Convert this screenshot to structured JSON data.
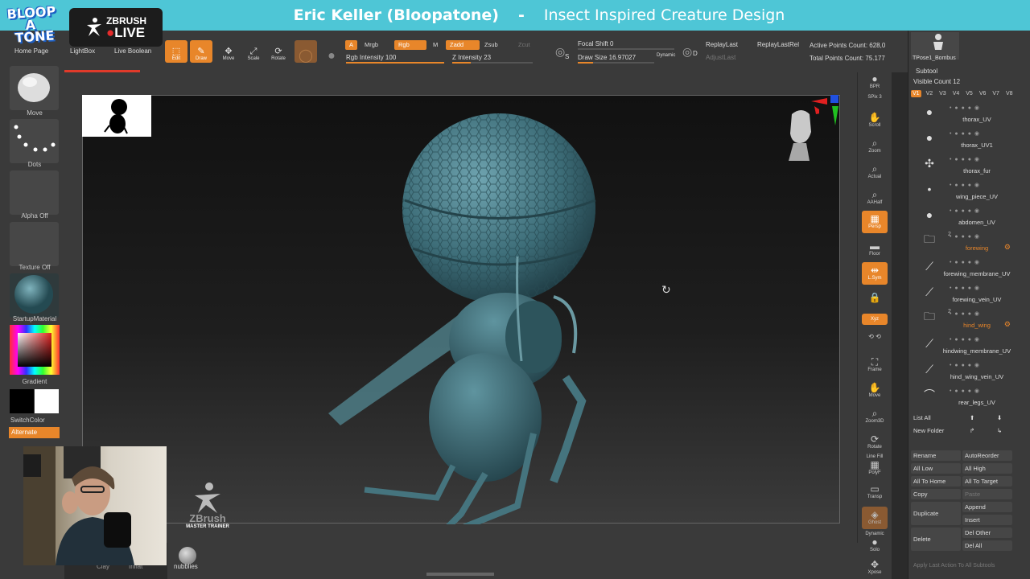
{
  "banner": {
    "author": "Eric Keller (Bloopatone)",
    "separator": "-",
    "course": "Insect Inspired Creature Design"
  },
  "logo": {
    "line1": "BLOOP",
    "line2": "A",
    "line3": "TONE"
  },
  "zbrush_live": {
    "top": "ZBRUSH",
    "live": "LIVE"
  },
  "top_nav": {
    "home_page": "Home Page",
    "lightbox": "LightBox",
    "live_boolean": "Live Boolean"
  },
  "tools": {
    "edit": "Edit",
    "draw": "Draw",
    "move": "Move",
    "scale": "Scale",
    "rotate": "Rotate"
  },
  "paint": {
    "a": "A",
    "mrgb": "Mrgb",
    "rgb": "Rgb",
    "m": "M",
    "zadd": "Zadd",
    "zsub": "Zsub",
    "zcut": "Zcut",
    "rgb_intensity": "Rgb Intensity 100",
    "z_intensity": "Z Intensity 23",
    "rgb_intensity_level": 1.0,
    "z_intensity_level": 0.23
  },
  "brush": {
    "focal_shift": "Focal Shift 0",
    "draw_size": "Draw Size 16.97027",
    "dynamic": "Dynamic",
    "s_key": "S",
    "d_key": "D"
  },
  "replay": {
    "replay_last": "ReplayLast",
    "replay_last_rel": "ReplayLastRel",
    "adjust_last": "AdjustLast"
  },
  "points": {
    "active": "Active Points Count: 628,0",
    "total": "Total Points Count: 75.177"
  },
  "left_panel": {
    "move": "Move",
    "dots": "Dots",
    "alpha": "Alpha Off",
    "texture": "Texture Off",
    "material": "StartupMaterial",
    "gradient": "Gradient",
    "switch_color": "SwitchColor",
    "alternate": "Alternate",
    "main_color": "#e02020"
  },
  "right_shelf": {
    "bpr": "BPR",
    "spix": "SPix 3",
    "scroll": "Scroll",
    "zoom": "Zoom",
    "actual": "Actual",
    "aahalf": "AAHalf",
    "persp": "Persp",
    "floor": "Floor",
    "lsym": "L.Sym",
    "xyz": "Xyz",
    "frame": "Frame",
    "move": "Move",
    "zoom3d": "Zoom3D",
    "rotate": "Rotate",
    "polyf": "PolyF",
    "line_fill": "Line Fill",
    "transp": "Transp",
    "ghost": "Ghost",
    "dynamic": "Dynamic",
    "solo": "Solo",
    "xpose": "Xpose"
  },
  "subtool": {
    "tpose_label": "TPose1_Bombus",
    "title": "Subtool",
    "visible_count": "Visible Count 12",
    "vtabs": [
      "V1",
      "V2",
      "V3",
      "V4",
      "V5",
      "V6",
      "V7",
      "V8"
    ],
    "items": [
      {
        "name": "thorax_UV",
        "icon": "sphere-icon"
      },
      {
        "name": "thorax_UV1",
        "icon": "sphere-icon"
      },
      {
        "name": "thorax_fur",
        "icon": "fur-icon"
      },
      {
        "name": "wing_piece_UV",
        "icon": "dot-icon"
      },
      {
        "name": "abdomen_UV",
        "icon": "sphere-icon"
      },
      {
        "name": "forewing",
        "icon": "folder-icon",
        "folder": true,
        "count": "2"
      },
      {
        "name": "forewing_membrane_UV",
        "icon": "line-icon"
      },
      {
        "name": "forewing_vein_UV",
        "icon": "line-icon"
      },
      {
        "name": "hind_wing",
        "icon": "folder-icon",
        "folder": true,
        "count": "2"
      },
      {
        "name": "hindwing_membrane_UV",
        "icon": "line-icon"
      },
      {
        "name": "hind_wing_vein_UV",
        "icon": "line-icon"
      },
      {
        "name": "rear_legs_UV",
        "icon": "leg-icon"
      }
    ],
    "list_all": "List All",
    "new_folder": "New Folder",
    "rename": "Rename",
    "auto_reorder": "AutoReorder",
    "all_low": "All Low",
    "all_high": "All High",
    "all_to_home": "All To Home",
    "all_to_target": "All To Target",
    "copy": "Copy",
    "paste": "Paste",
    "duplicate": "Duplicate",
    "append": "Append",
    "insert": "Insert",
    "delete": "Delete",
    "del_other": "Del Other",
    "del_all": "Del All",
    "apply_last": "Apply Last Action To All Subtools"
  },
  "watermark": {
    "line1": "ZBrush",
    "line2": "MASTER TRAINER"
  },
  "bottom": {
    "nubblies": "nubblies",
    "clay": "Clay",
    "inflat": "Inflat"
  }
}
